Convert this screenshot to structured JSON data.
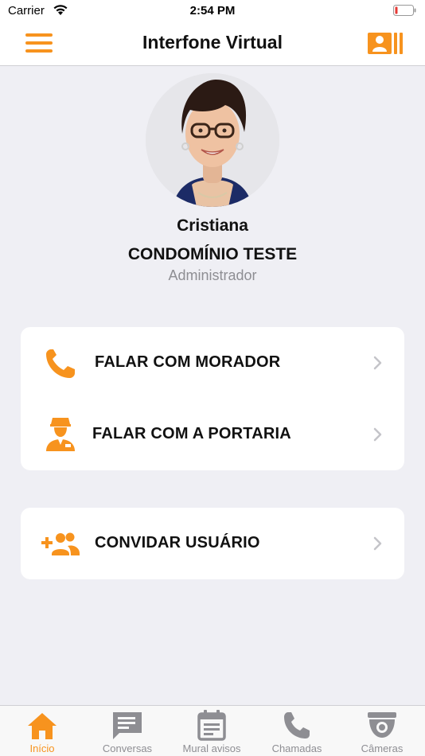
{
  "status_bar": {
    "carrier": "Carrier",
    "time": "2:54 PM"
  },
  "nav": {
    "title": "Interfone Virtual"
  },
  "profile": {
    "name": "Cristiana",
    "condominium": "CONDOMÍNIO TESTE",
    "role": "Administrador"
  },
  "actions": {
    "call_resident": "FALAR COM MORADOR",
    "call_concierge": "FALAR COM A PORTARIA",
    "invite_user": "CONVIDAR USUÁRIO"
  },
  "tabs": [
    {
      "label": "Início",
      "icon": "home-icon",
      "active": true
    },
    {
      "label": "Conversas",
      "icon": "chat-icon",
      "active": false
    },
    {
      "label": "Mural avisos",
      "icon": "notice-board-icon",
      "active": false
    },
    {
      "label": "Chamadas",
      "icon": "phone-icon",
      "active": false
    },
    {
      "label": "Câmeras",
      "icon": "camera-icon",
      "active": false
    }
  ],
  "colors": {
    "accent": "#f7931e",
    "inactive": "#8e8e93",
    "background": "#efeff4"
  }
}
